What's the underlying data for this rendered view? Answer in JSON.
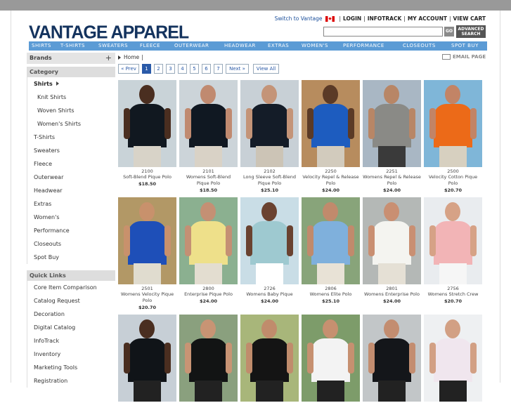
{
  "header": {
    "switch_label": "Switch to Vantage",
    "links": [
      "LOGIN",
      "INFOTRACK",
      "MY ACCOUNT",
      "VIEW CART"
    ],
    "logo": "VANTAGE APPAREL",
    "search_placeholder": "",
    "go_label": "GO",
    "advanced_label_1": "ADVANCED",
    "advanced_label_2": "SEARCH"
  },
  "nav": [
    "SHIRTS",
    "T-SHIRTS",
    "SWEATERS",
    "FLEECE",
    "OUTERWEAR",
    "HEADWEAR",
    "EXTRAS",
    "WOMEN'S",
    "PERFORMANCE",
    "CLOSEOUTS",
    "SPOT BUY"
  ],
  "sidebar": {
    "brands_label": "Brands",
    "brands_toggle": "+",
    "category_label": "Category",
    "categories": [
      {
        "label": "Shirts",
        "active": true,
        "sub": false
      },
      {
        "label": "Knit Shirts",
        "sub": true
      },
      {
        "label": "Woven Shirts",
        "sub": true
      },
      {
        "label": "Women's Shirts",
        "sub": true
      },
      {
        "label": "T-Shirts",
        "sub": false
      },
      {
        "label": "Sweaters",
        "sub": false
      },
      {
        "label": "Fleece",
        "sub": false
      },
      {
        "label": "Outerwear",
        "sub": false
      },
      {
        "label": "Headwear",
        "sub": false
      },
      {
        "label": "Extras",
        "sub": false
      },
      {
        "label": "Women's",
        "sub": false
      },
      {
        "label": "Performance",
        "sub": false
      },
      {
        "label": "Closeouts",
        "sub": false
      },
      {
        "label": "Spot Buy",
        "sub": false
      }
    ],
    "quick_links_label": "Quick Links",
    "quick_links": [
      "Core Item Comparison",
      "Catalog Request",
      "Decoration",
      "Digital Catalog",
      "InfoTrack",
      "Inventory",
      "Marketing Tools",
      "Registration"
    ]
  },
  "breadcrumb": {
    "home": "Home",
    "sep": "|"
  },
  "email_page": "EMAIL PAGE",
  "pager": {
    "prev": "« Prev",
    "pages": [
      "1",
      "2",
      "3",
      "4",
      "5",
      "6",
      "7"
    ],
    "current": "1",
    "next": "Next »",
    "view_all": "View All"
  },
  "products": [
    {
      "code": "2100",
      "name": "Soft-Blend Pique Polo",
      "price": "$18.50",
      "shirt": "#111820",
      "skin": "#4a2e20",
      "bg": "#c9d3d8",
      "pants": "#d8d3c8"
    },
    {
      "code": "2101",
      "name": "Womens Soft-Blend Pique Polo",
      "price": "$18.50",
      "shirt": "#101822",
      "skin": "#c08a70",
      "bg": "#ccd4d9",
      "pants": "#d9d2c6"
    },
    {
      "code": "2102",
      "name": "Long Sleeve Soft-Blend Pique Polo",
      "price": "$25.10",
      "shirt": "#141c28",
      "skin": "#c49478",
      "bg": "#c8d0d6",
      "pants": "#ccc4b6"
    },
    {
      "code": "2250",
      "name": "Velocity Repel & Release Polo",
      "price": "$24.00",
      "shirt": "#1d5cbf",
      "skin": "#5b3a26",
      "bg": "#b78c5e",
      "pants": "#d2cbbd"
    },
    {
      "code": "2251",
      "name": "Womens Repel & Release Polo",
      "price": "$24.00",
      "shirt": "#8a8a86",
      "skin": "#b88666",
      "bg": "#a9b7c4",
      "pants": "#3a3a3a"
    },
    {
      "code": "2500",
      "name": "Velocity Cotton Pique Polo",
      "price": "$20.70",
      "shirt": "#ec6a18",
      "skin": "#c28466",
      "bg": "#7fb6d8",
      "pants": "#d7d0c0"
    },
    {
      "code": "2501",
      "name": "Womens Velocity Pique Polo",
      "price": "$20.70",
      "shirt": "#1e4fb8",
      "skin": "#c8916c",
      "bg": "#b29866",
      "pants": "#e0dccf"
    },
    {
      "code": "2800",
      "name": "Enterprise Pique Polo",
      "price": "$24.00",
      "shirt": "#eee08a",
      "skin": "#c49074",
      "bg": "#8bb090",
      "pants": "#e3ddd0"
    },
    {
      "code": "2726",
      "name": "Womens Baby Pique",
      "price": "$24.00",
      "shirt": "#9ec9d0",
      "skin": "#6a4230",
      "bg": "#c9dde6",
      "pants": "#ffffff"
    },
    {
      "code": "2806",
      "name": "Womens Elite Polo",
      "price": "$25.10",
      "shirt": "#7fb0dc",
      "skin": "#c18a6c",
      "bg": "#88a47a",
      "pants": "#e8e2d6"
    },
    {
      "code": "2801",
      "name": "Womens Enterprise Polo",
      "price": "$24.00",
      "shirt": "#f4f4f0",
      "skin": "#c98f72",
      "bg": "#b4b8b6",
      "pants": "#e5e0d5"
    },
    {
      "code": "2756",
      "name": "Womens Stretch Crew",
      "price": "$20.70",
      "shirt": "#f2b4b6",
      "skin": "#d6a286",
      "bg": "#e9ecef",
      "pants": "#f6f6f6"
    },
    {
      "code": "",
      "name": "",
      "price": "",
      "shirt": "#101418",
      "skin": "#4a2e20",
      "bg": "#c7cfd6",
      "pants": "#222"
    },
    {
      "code": "",
      "name": "",
      "price": "",
      "shirt": "#121414",
      "skin": "#c89474",
      "bg": "#8aa07e",
      "pants": "#222"
    },
    {
      "code": "",
      "name": "",
      "price": "",
      "shirt": "#141414",
      "skin": "#c08c6c",
      "bg": "#a8b67a",
      "pants": "#222"
    },
    {
      "code": "",
      "name": "",
      "price": "",
      "shirt": "#f3f3f3",
      "skin": "#c69070",
      "bg": "#7d9c6a",
      "pants": "#222"
    },
    {
      "code": "",
      "name": "",
      "price": "",
      "shirt": "#14161a",
      "skin": "#c38d70",
      "bg": "#c2c6c8",
      "pants": "#222"
    },
    {
      "code": "",
      "name": "",
      "price": "",
      "shirt": "#f0e6ee",
      "skin": "#d2a084",
      "bg": "#eef0f2",
      "pants": "#222"
    }
  ]
}
